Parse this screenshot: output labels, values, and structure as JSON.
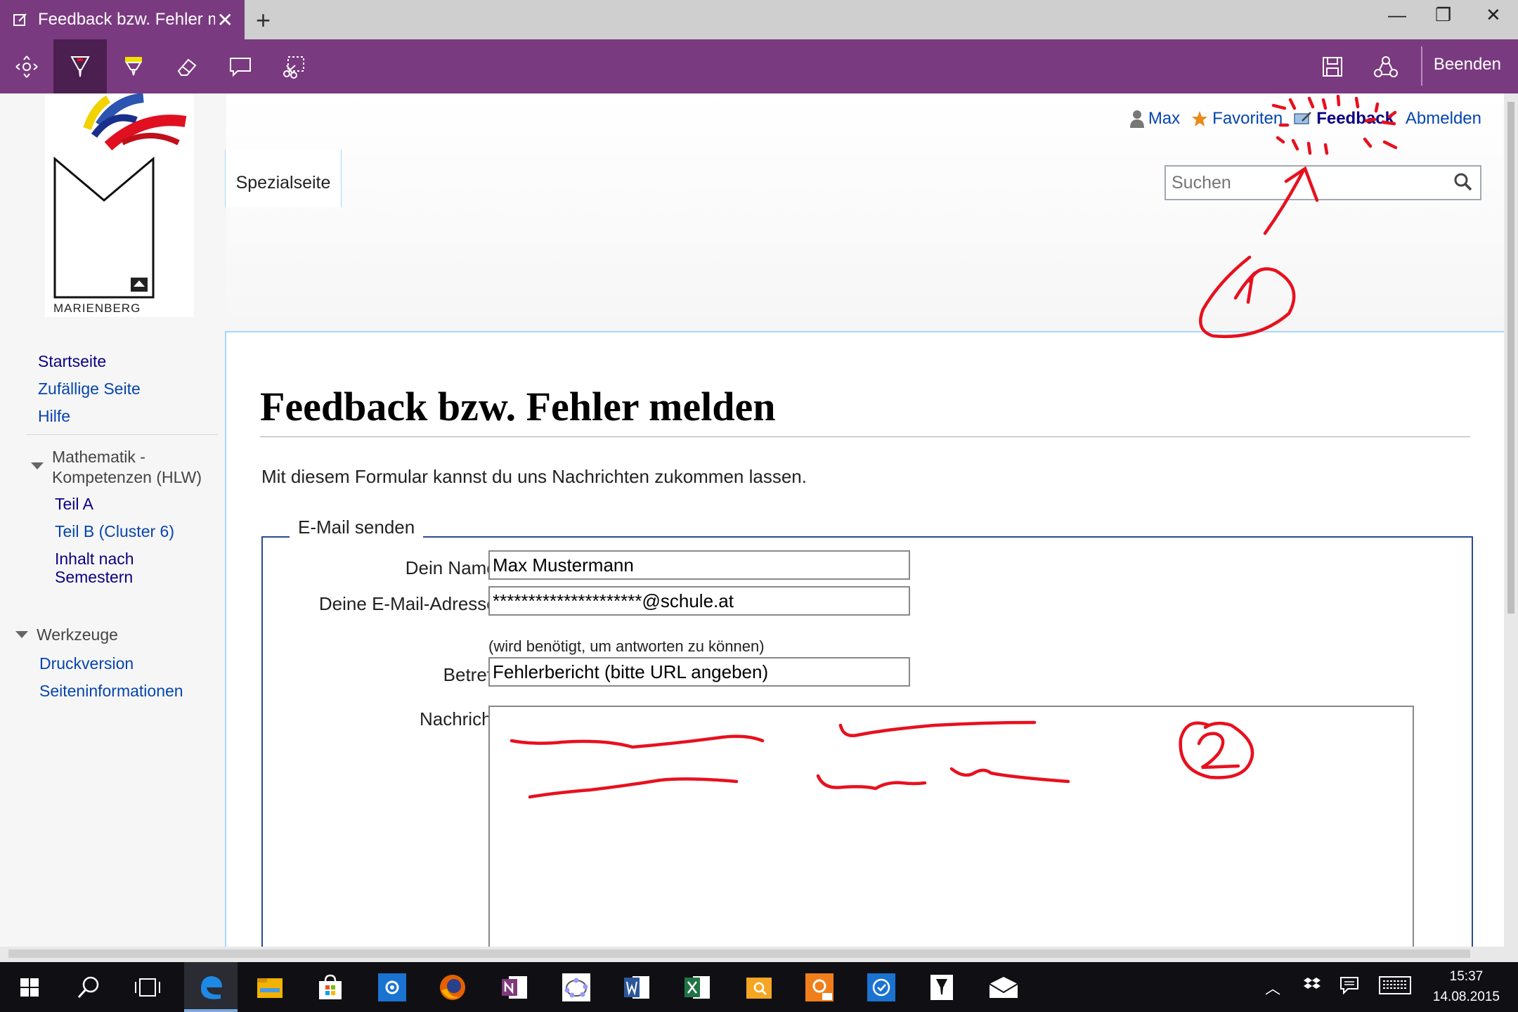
{
  "browser": {
    "tab_title": "Feedback bzw. Fehler m",
    "new_tab": "+",
    "window_controls": {
      "minimize": "—",
      "restore": "❐",
      "close": "✕"
    }
  },
  "note_toolbar": {
    "tools": [
      "pan-icon",
      "pen-icon",
      "highlighter-icon",
      "eraser-icon",
      "comment-icon",
      "clip-icon"
    ],
    "active_tool": "pen-icon",
    "save_icon": "save-icon",
    "share_icon": "share-icon",
    "exit_label": "Beenden"
  },
  "site": {
    "logo_text": "MARIENBERG",
    "page_tab": "Spezialseite",
    "personal": {
      "user": "Max",
      "favorites": "Favoriten",
      "feedback": "Feedback",
      "logout": "Abmelden"
    },
    "search": {
      "placeholder": "Suchen"
    }
  },
  "sidebar": {
    "nav": [
      {
        "label": "Startseite",
        "visited": true
      },
      {
        "label": "Zufällige Seite"
      },
      {
        "label": "Hilfe"
      }
    ],
    "portal": {
      "heading_line1": "Mathematik -",
      "heading_line2": "Kompetenzen (HLW)",
      "items": [
        {
          "label": "Teil A",
          "visited": true
        },
        {
          "label": "Teil B (Cluster 6)"
        },
        {
          "label_line1": "Inhalt nach",
          "label_line2": "Semestern",
          "visited": true
        }
      ]
    },
    "tools": {
      "heading": "Werkzeuge",
      "items": [
        "Druckversion",
        "Seiteninformationen"
      ]
    }
  },
  "content": {
    "title": "Feedback bzw. Fehler melden",
    "intro": "Mit diesem Formular kannst du uns Nachrichten zukommen lassen.",
    "form": {
      "legend": "E-Mail senden",
      "name_label": "Dein Name:",
      "name_value": "Max Mustermann",
      "email_label": "Deine E-Mail-Adresse:",
      "email_value": "*********************@schule.at",
      "email_hint": "(wird benötigt, um antworten zu können)",
      "subject_label": "Betreff:",
      "subject_value": "Fehlerbericht (bitte URL angeben)",
      "message_label": "Nachricht:"
    }
  },
  "ink_annotations": {
    "mark_1": "1",
    "mark_2": "2",
    "color": "#e8101e"
  },
  "taskbar": {
    "apps": [
      "start-icon",
      "search-icon",
      "task-view-icon",
      "edge-icon",
      "file-explorer-icon",
      "store-icon",
      "settings-icon",
      "firefox-icon",
      "onenote-icon",
      "geogebra-icon",
      "word-icon",
      "excel-icon",
      "file-search-icon",
      "pdf-icon",
      "todo-icon",
      "pen-app-icon",
      "mail-icon"
    ],
    "time": "15:37",
    "date": "14.08.2015"
  }
}
